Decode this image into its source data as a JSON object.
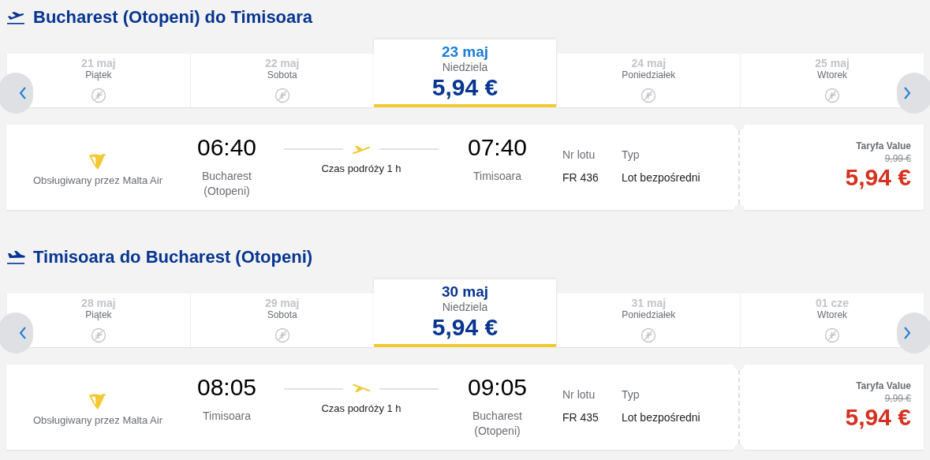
{
  "sections": [
    {
      "kind": "outbound",
      "title": "Bucharest (Otopeni) do Timisoara",
      "days": [
        {
          "date": "21 maj",
          "weekday": "Piątek",
          "selected": false,
          "hovered": false
        },
        {
          "date": "22 maj",
          "weekday": "Sobota",
          "selected": false,
          "hovered": false
        },
        {
          "date": "23 maj",
          "weekday": "Niedziela",
          "price": "5,94 €",
          "selected": true,
          "hovered": true
        },
        {
          "date": "24 maj",
          "weekday": "Poniedziałek",
          "selected": false,
          "hovered": false
        },
        {
          "date": "25 maj",
          "weekday": "Wtorek",
          "selected": false,
          "hovered": false
        }
      ],
      "flight": {
        "operator": "Obsługiwany przez Malta Air",
        "departure_time": "06:40",
        "departure_city": "Bucharest (Otopeni)",
        "duration": "Czas podróży 1 h",
        "arrival_time": "07:40",
        "arrival_city": "Timisoara",
        "flight_no_label": "Nr lotu",
        "flight_no": "FR 436",
        "type_label": "Typ",
        "type": "Lot bezpośredni",
        "fare_label": "Taryfa Value",
        "old_price": "9,99 €",
        "price": "5,94 €"
      }
    },
    {
      "kind": "return",
      "title": "Timisoara do Bucharest (Otopeni)",
      "days": [
        {
          "date": "28 maj",
          "weekday": "Piątek",
          "selected": false,
          "hovered": false
        },
        {
          "date": "29 maj",
          "weekday": "Sobota",
          "selected": false,
          "hovered": false
        },
        {
          "date": "30 maj",
          "weekday": "Niedziela",
          "price": "5,94 €",
          "selected": true,
          "hovered": false
        },
        {
          "date": "31 maj",
          "weekday": "Poniedziałek",
          "selected": false,
          "hovered": false
        },
        {
          "date": "01 cze",
          "weekday": "Wtorek",
          "selected": false,
          "hovered": false
        }
      ],
      "flight": {
        "operator": "Obsługiwany przez Malta Air",
        "departure_time": "08:05",
        "departure_city": "Timisoara",
        "duration": "Czas podróży 1 h",
        "arrival_time": "09:05",
        "arrival_city": "Bucharest (Otopeni)",
        "flight_no_label": "Nr lotu",
        "flight_no": "FR 435",
        "type_label": "Typ",
        "type": "Lot bezpośredni",
        "fare_label": "Taryfa Value",
        "old_price": "9,99 €",
        "price": "5,94 €"
      }
    }
  ]
}
